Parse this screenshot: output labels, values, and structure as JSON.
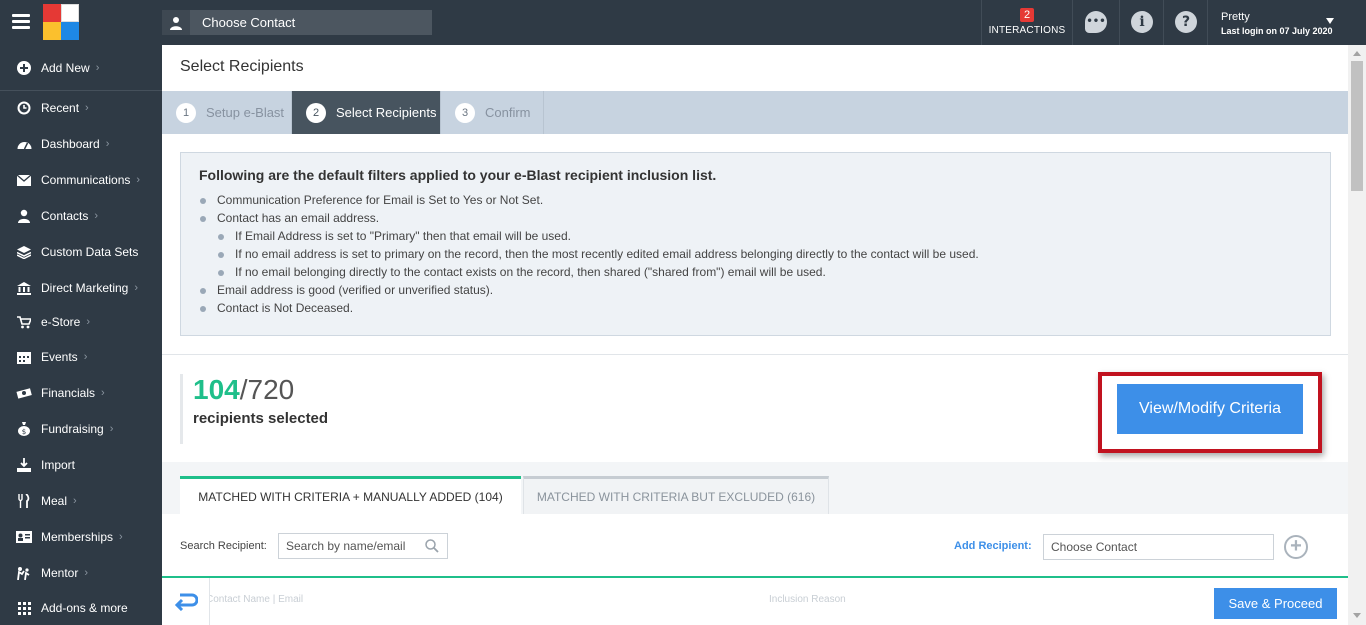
{
  "topbar": {
    "contact_picker_label": "Choose Contact",
    "interactions_count": "2",
    "interactions_label": "INTERACTIONS",
    "icons": [
      "chat-icon",
      "info-icon",
      "help-icon"
    ],
    "user_name": "Pretty",
    "last_login": "Last login on 07 July 2020"
  },
  "sidebar": {
    "items": [
      {
        "label": "Add New",
        "icon": "plus-circle-icon"
      },
      {
        "label": "Recent",
        "icon": "history-icon"
      },
      {
        "label": "Dashboard",
        "icon": "dashboard-icon"
      },
      {
        "label": "Communications",
        "icon": "envelope-icon"
      },
      {
        "label": "Contacts",
        "icon": "user-icon"
      },
      {
        "label": "Custom Data Sets",
        "icon": "layers-icon"
      },
      {
        "label": "Direct Marketing",
        "icon": "bank-icon"
      },
      {
        "label": "e-Store",
        "icon": "cart-icon"
      },
      {
        "label": "Events",
        "icon": "calendar-icon"
      },
      {
        "label": "Financials",
        "icon": "money-icon"
      },
      {
        "label": "Fundraising",
        "icon": "money-bag-icon"
      },
      {
        "label": "Import",
        "icon": "import-icon"
      },
      {
        "label": "Meal",
        "icon": "cutlery-icon"
      },
      {
        "label": "Memberships",
        "icon": "id-card-icon"
      },
      {
        "label": "Mentor",
        "icon": "mentor-icon"
      },
      {
        "label": "Add-ons & more",
        "icon": "grid-icon"
      }
    ]
  },
  "page": {
    "title": "Select Recipients",
    "steps": [
      {
        "num": "1",
        "label": "Setup e-Blast"
      },
      {
        "num": "2",
        "label": "Select Recipients"
      },
      {
        "num": "3",
        "label": "Confirm"
      }
    ],
    "filters": {
      "heading": "Following are the default filters applied to your e-Blast recipient inclusion list.",
      "rules": [
        "Communication Preference for Email is Set to Yes or Not Set.",
        "Contact has an email address.",
        "If Email Address is set to \"Primary\" then that email will be used.",
        "If no email address is set to primary on the record, then the most recently edited email address belonging directly to the contact will be used.",
        "If no email belonging directly to the contact exists on the record, then shared (\"shared from\") email will be used.",
        "Email address is good (verified or unverified status).",
        "Contact is Not Deceased."
      ]
    },
    "recipients": {
      "selected": "104",
      "total": "/720",
      "label": "recipients selected"
    },
    "criteria_button": "View/Modify Criteria",
    "tabs": [
      {
        "label": "MATCHED WITH CRITERIA + MANUALLY ADDED (104)"
      },
      {
        "label": "MATCHED WITH CRITERIA BUT EXCLUDED (616)"
      }
    ],
    "search": {
      "label": "Search Recipient:",
      "placeholder": "Search by name/email"
    },
    "add_recipient": {
      "label": "Add Recipient:",
      "placeholder": "Choose Contact"
    },
    "table_columns": [
      "Contact Name | Email",
      "Inclusion Reason"
    ],
    "save_button": "Save & Proceed"
  },
  "colors": {
    "sidebar_bg": "#2f3a45",
    "accent_blue": "#3d8fe8",
    "accent_green": "#1fbf8a",
    "highlight_red": "#c1121f"
  }
}
